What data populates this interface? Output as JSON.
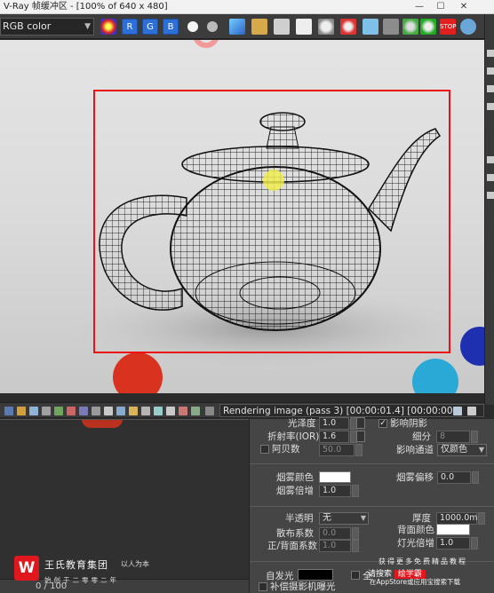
{
  "window": {
    "title": "V-Ray 帧缓冲区 - [100% of 640 x 480]"
  },
  "toolbar": {
    "channel_value": "RGB color",
    "rgb_buttons": [
      "R",
      "G",
      "B"
    ]
  },
  "status": {
    "text": "Rendering image (pass 3) [00:00:01.4] [00:00:00.0 est]"
  },
  "timeline": {
    "frame": "0 / 100"
  },
  "panel": {
    "glossiness": {
      "label": "光泽度",
      "value": "1.0"
    },
    "affect_shadows_label": "影响阴影",
    "ior": {
      "label": "折射率(IOR)",
      "value": "1.6"
    },
    "subdivs": {
      "label": "细分",
      "value": "8"
    },
    "abbe": {
      "label": "阿贝数",
      "value": "50.0"
    },
    "affect_channels": {
      "label": "影响通道",
      "value": "仅颜色"
    },
    "fog_color_label": "烟雾颜色",
    "fog_bias": {
      "label": "烟雾偏移",
      "value": "0.0"
    },
    "fog_multiplier": {
      "label": "烟雾倍增",
      "value": "1.0"
    },
    "translucency": {
      "label": "半透明",
      "value": "无"
    },
    "thickness": {
      "label": "厚度",
      "value": "1000.0m"
    },
    "scatter_coeff": {
      "label": "散布系数",
      "value": "0.0"
    },
    "back_color_label": "背面颜色",
    "fwd_bck_coeff": {
      "label": "正/背面系数",
      "value": "1.0"
    },
    "light_multiplier": {
      "label": "灯光倍增",
      "value": "1.0"
    },
    "self_illum_label": "自发光",
    "gi_prefix": "全",
    "compensate_label": "补偿摄影机曝光"
  },
  "watermark": {
    "logo_letter": "W",
    "company": "王氏教育集团",
    "slogan": "以人为本",
    "sub": "始创于二零零二年",
    "line1": "获得更多免费精品教程",
    "line2_prefix": "请搜索",
    "line2_brand": "绘学霸",
    "line3": "在AppStore或应用宝搜索下载"
  },
  "colors": {
    "frame_border": "#e11111",
    "rgb_button": "#2d6fd6",
    "fog_color": "#ffffff",
    "back_color": "#ffffff",
    "self_illum_color": "#000000"
  }
}
